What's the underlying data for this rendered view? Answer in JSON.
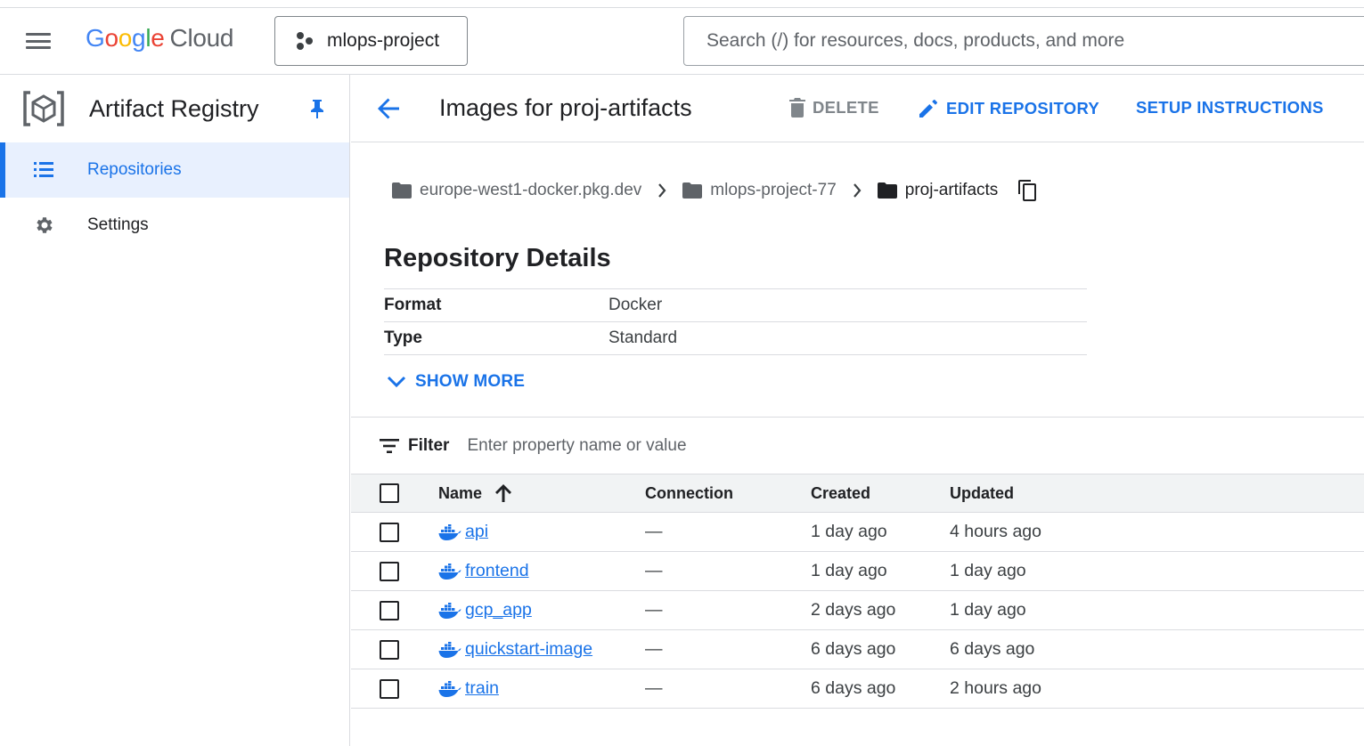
{
  "topbar": {
    "logo": {
      "g1": "G",
      "o1": "o",
      "o2": "o",
      "g2": "g",
      "l": "l",
      "e": "e",
      "cloud": "Cloud"
    },
    "project": "mlops-project",
    "search_placeholder": "Search (/) for resources, docs, products, and more"
  },
  "sidebar": {
    "title": "Artifact Registry",
    "items": [
      {
        "label": "Repositories",
        "icon": "list-icon",
        "active": true
      },
      {
        "label": "Settings",
        "icon": "gear-icon",
        "active": false
      }
    ]
  },
  "header": {
    "title": "Images for proj-artifacts",
    "delete_label": "DELETE",
    "edit_label": "EDIT REPOSITORY",
    "setup_label": "SETUP INSTRUCTIONS"
  },
  "breadcrumb": [
    "europe-west1-docker.pkg.dev",
    "mlops-project-77",
    "proj-artifacts"
  ],
  "details": {
    "title": "Repository Details",
    "rows": [
      {
        "key": "Format",
        "value": "Docker"
      },
      {
        "key": "Type",
        "value": "Standard"
      }
    ],
    "show_more": "SHOW MORE"
  },
  "filter": {
    "label": "Filter",
    "placeholder": "Enter property name or value"
  },
  "table": {
    "columns": {
      "name": "Name",
      "connection": "Connection",
      "created": "Created",
      "updated": "Updated"
    },
    "rows": [
      {
        "name": "api",
        "connection": "—",
        "created": "1 day ago",
        "updated": "4 hours ago"
      },
      {
        "name": "frontend",
        "connection": "—",
        "created": "1 day ago",
        "updated": "1 day ago"
      },
      {
        "name": "gcp_app",
        "connection": "—",
        "created": "2 days ago",
        "updated": "1 day ago"
      },
      {
        "name": "quickstart-image",
        "connection": "—",
        "created": "6 days ago",
        "updated": "6 days ago"
      },
      {
        "name": "train",
        "connection": "—",
        "created": "6 days ago",
        "updated": "2 hours ago"
      }
    ]
  },
  "colors": {
    "accent": "#1a73e8",
    "text": "#202124",
    "muted": "#5f6368",
    "border": "#dadce0"
  }
}
